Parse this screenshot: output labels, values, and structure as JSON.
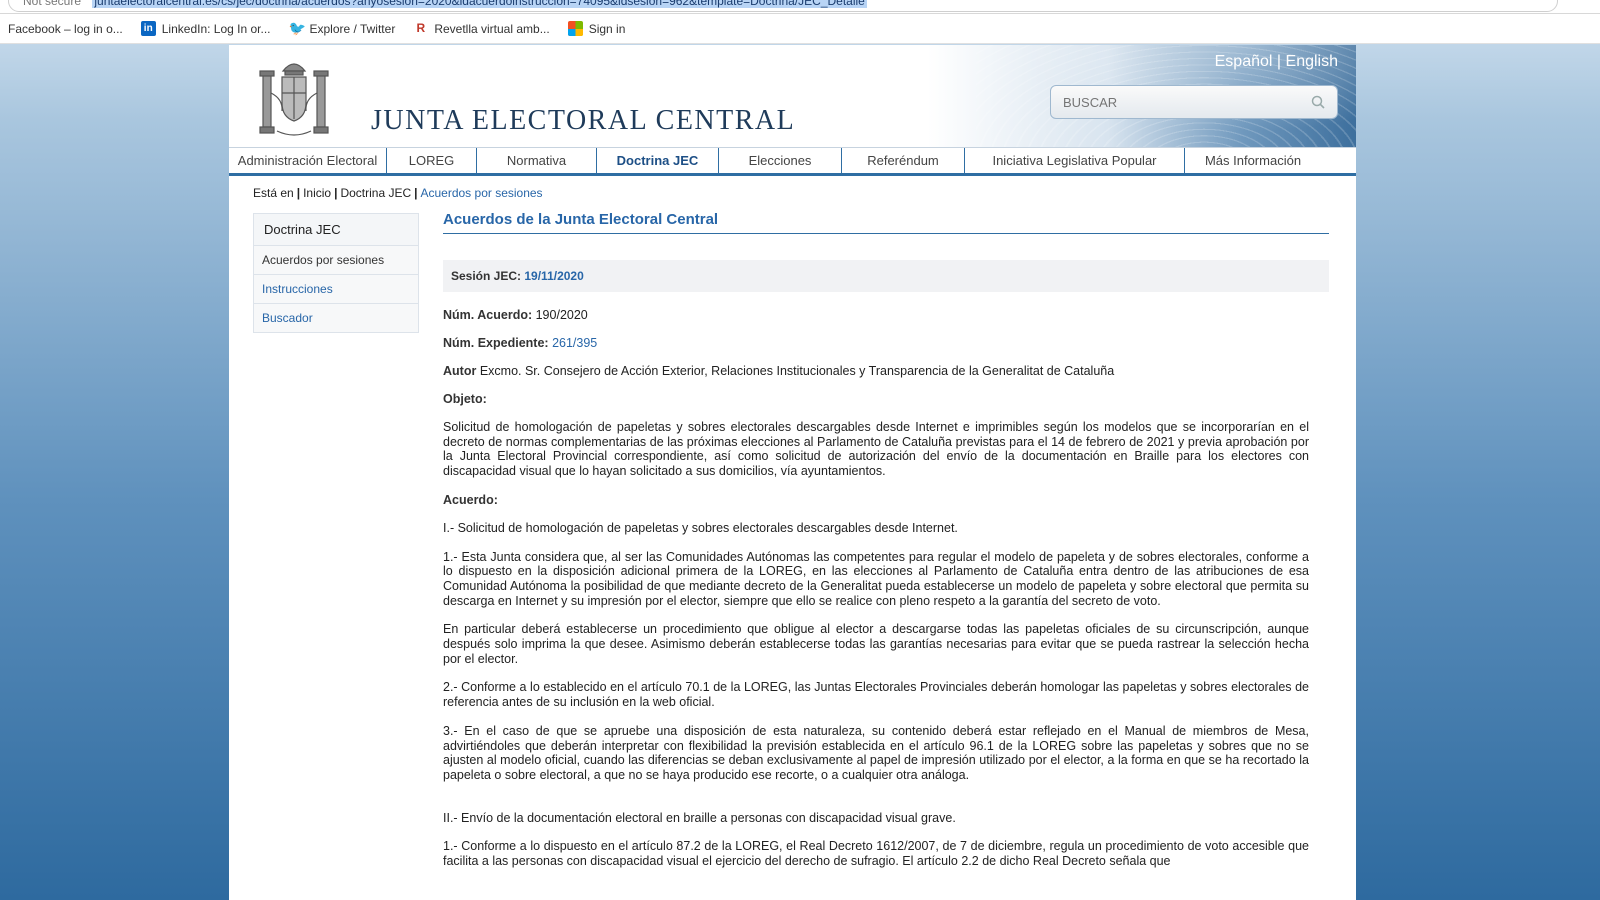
{
  "browser": {
    "security": "Not secure",
    "url": "juntaelectoralcentral.es/cs/jec/doctrina/acuerdos?anyosesion=2020&idacuerdoinstruccion=74095&idsesion=962&template=Doctrina/JEC_Detalle",
    "bookmarks": [
      {
        "label": "Facebook – log in o...",
        "icon": "facebook-icon"
      },
      {
        "label": "LinkedIn: Log In or...",
        "icon": "linkedin-icon"
      },
      {
        "label": "Explore / Twitter",
        "icon": "twitter-icon"
      },
      {
        "label": "Revetlla virtual amb...",
        "icon": "revetlla-icon"
      },
      {
        "label": "Sign in",
        "icon": "microsoft-icon"
      }
    ]
  },
  "header": {
    "brand": "JUNTA ELECTORAL CENTRAL",
    "lang_es": "Español",
    "lang_sep": "|",
    "lang_en": "English",
    "search_placeholder": "BUSCAR"
  },
  "nav": [
    {
      "label": "Administración Electoral",
      "active": false
    },
    {
      "label": "LOREG",
      "active": false
    },
    {
      "label": "Normativa",
      "active": false
    },
    {
      "label": "Doctrina JEC",
      "active": true
    },
    {
      "label": "Elecciones",
      "active": false
    },
    {
      "label": "Referéndum",
      "active": false
    },
    {
      "label": "Iniciativa Legislativa Popular",
      "active": false
    },
    {
      "label": "Más Información",
      "active": false
    }
  ],
  "breadcrumb": {
    "prefix": "Está en",
    "items": [
      "Inicio",
      "Doctrina JEC"
    ],
    "current": "Acuerdos por sesiones"
  },
  "sidebar": {
    "title": "Doctrina JEC",
    "items": [
      {
        "label": "Acuerdos por sesiones"
      },
      {
        "label": "Instrucciones"
      },
      {
        "label": "Buscador"
      }
    ]
  },
  "content": {
    "title": "Acuerdos de la Junta Electoral Central",
    "session_label": "Sesión JEC:",
    "session_date": "19/11/2020",
    "num_acuerdo_label": "Núm. Acuerdo:",
    "num_acuerdo": "190/2020",
    "num_expediente_label": "Núm. Expediente:",
    "num_expediente": "261/395",
    "autor_label": "Autor",
    "autor": "Excmo. Sr. Consejero de Acción Exterior, Relaciones Institucionales y Transparencia de la Generalitat de Cataluña",
    "objeto_label": "Objeto:",
    "objeto": "Solicitud de homologación de papeletas y sobres electorales descargables desde Internet e imprimibles según los modelos que se incorporarían en el decreto de normas complementarias de las próximas elecciones al Parlamento de Cataluña previstas para el 14 de febrero de 2021 y previa aprobación por la Junta Electoral Provincial correspondiente, así como solicitud de autorización del envío de la documentación en Braille para los electores con discapacidad visual que lo hayan solicitado a sus domicilios, vía ayuntamientos.",
    "acuerdo_label": "Acuerdo:",
    "section1": "I.- Solicitud de homologación de papeletas y sobres electorales descargables desde Internet.",
    "p1": "1.- Esta Junta considera que, al ser las Comunidades Autónomas las competentes para regular el modelo de papeleta y de sobres electorales, conforme a lo dispuesto en la disposición adicional primera de la LOREG, en las elecciones al Parlamento de Cataluña entra dentro de las atribuciones de esa Comunidad Autónoma la posibilidad de que mediante decreto de la Generalitat pueda establecerse un modelo de papeleta y sobre electoral que permita su descarga en Internet y su impresión por el elector, siempre que ello se realice con pleno respeto a la garantía del secreto de voto.",
    "p2": "En particular deberá establecerse un procedimiento que obligue al elector a descargarse todas las papeletas oficiales de su circunscripción, aunque después solo imprima la que desee. Asimismo deberán establecerse todas las garantías necesarias para evitar que se pueda rastrear la selección hecha por el elector.",
    "p3": "2.- Conforme a lo establecido en el artículo 70.1 de la LOREG, las Juntas Electorales Provinciales deberán homologar las papeletas y sobres electorales de referencia antes de su inclusión en la web oficial.",
    "p4": "3.- En el caso de que se apruebe una disposición de esta naturaleza, su contenido deberá estar reflejado en el Manual de miembros de Mesa, advirtiéndoles que deberán interpretar con flexibilidad la previsión establecida en el artículo 96.1 de la LOREG sobre las papeletas y sobres que no se ajusten al modelo oficial, cuando las diferencias se deban exclusivamente al papel de impresión utilizado por el elector, a la forma en que se ha recortado la papeleta o sobre electoral, a que no se haya producido ese recorte, o a cualquier otra análoga.",
    "section2": "II.- Envío de la documentación electoral en braille a personas con discapacidad visual grave.",
    "p5": "1.- Conforme a lo dispuesto en el artículo 87.2 de la LOREG, el Real Decreto 1612/2007, de 7 de diciembre, regula un procedimiento de voto accesible que facilita a las personas con discapacidad visual el ejercicio del derecho de sufragio. El artículo 2.2 de dicho Real Decreto señala que"
  }
}
